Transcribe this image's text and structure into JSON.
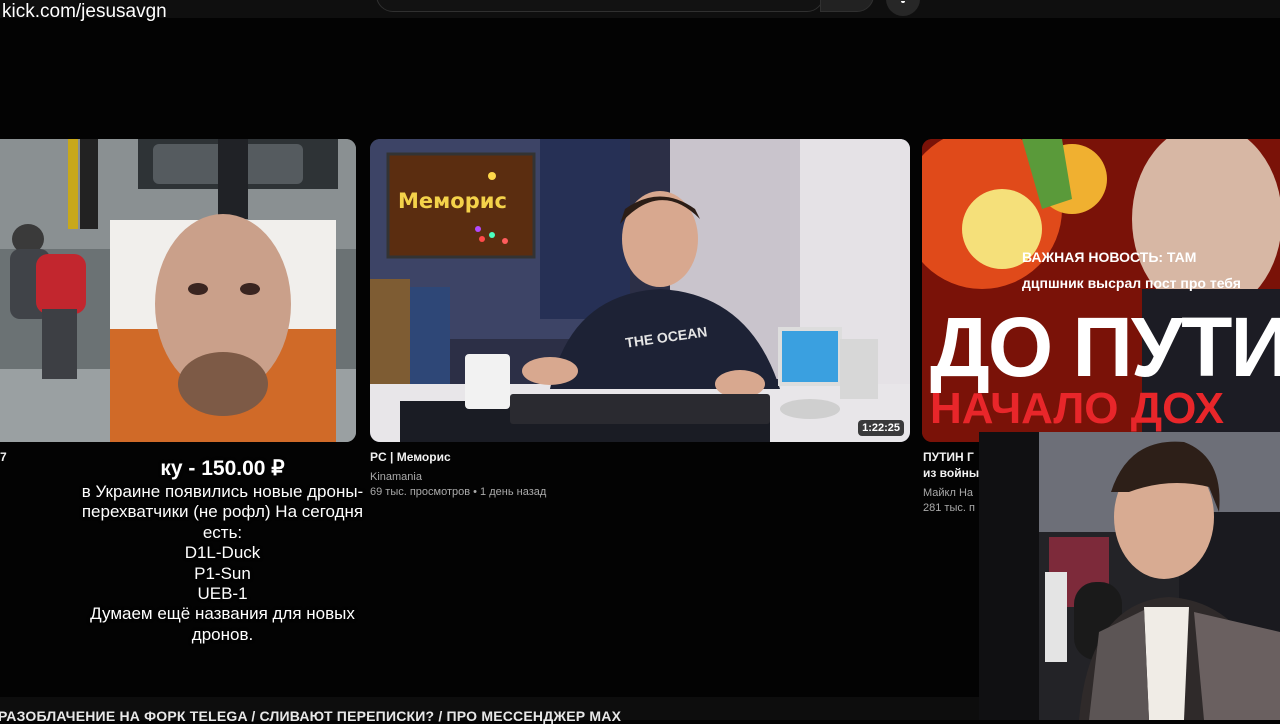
{
  "overlay": {
    "stream_url": "kick.com/jesusavgn"
  },
  "videos": [
    {
      "title": "7",
      "channel": "",
      "views": ""
    },
    {
      "title": "PC | Меморис",
      "channel": "Kinamania",
      "views": "69 тыс. просмотров • 1 день назад",
      "duration": "1:22:25",
      "thumb_badge": "Меморис",
      "shirt_text": "THE OCEAN"
    },
    {
      "title": "ПУТИН Г",
      "title_line2": "из войны",
      "channel": "Майкл На",
      "views": "281 тыс. п",
      "thumb_text_1": "ВАЖНАЯ НОВОСТЬ: ТАМ",
      "thumb_text_2": "дцпшник высрал пост про тебя",
      "thumb_big_1": "ДО ПУТИ",
      "thumb_big_2": "НАЧАЛО ДОХ"
    }
  ],
  "donation": {
    "amount": "ку - 150.00 ₽",
    "message": "в Украине появились новые дроны-\nперехватчики (не рофл) На сегодня\nесть:\nD1L-Duck\nP1-Sun\nUEB-1\nДумаем ещё названия для новых\nдронов."
  },
  "bottom_title": "РАЗОБЛАЧЕНИЕ НА ФОРК TELEGA / СЛИВАЮТ ПЕРЕПИСКИ? / ПРО МЕССЕНДЖЕР MAX",
  "colors": {
    "background": "#030303",
    "accent_red": "#e8262a",
    "text_secondary": "#aaaaaa"
  }
}
